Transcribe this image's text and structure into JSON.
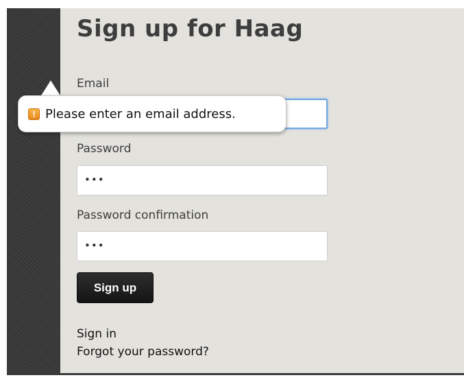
{
  "page": {
    "title": "Sign up for Haag"
  },
  "form": {
    "email": {
      "label": "Email",
      "value": ""
    },
    "password": {
      "label": "Password",
      "value": "•••"
    },
    "password_confirmation": {
      "label": "Password confirmation",
      "value": "•••"
    },
    "submit_label": "Sign up"
  },
  "links": {
    "sign_in": "Sign in",
    "forgot_password": "Forgot your password?"
  },
  "validation_tooltip": {
    "icon": "warning-icon",
    "icon_glyph": "!",
    "message": "Please enter an email address."
  },
  "colors": {
    "panel_background": "#e3e2dd",
    "button_background": "#1f1f1f",
    "focus_border": "#6fa6e6",
    "warning_icon": "#f0a030"
  }
}
